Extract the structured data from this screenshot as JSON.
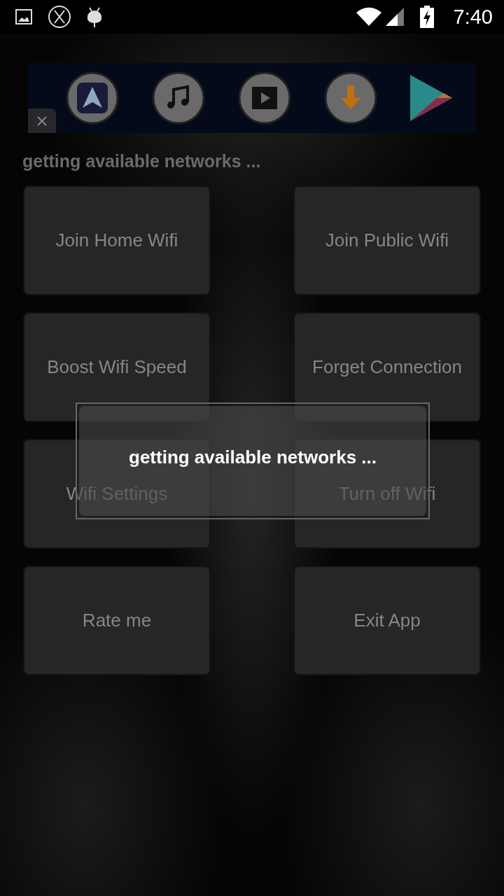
{
  "status_bar": {
    "time": "7:40"
  },
  "status_text": "getting available networks ...",
  "buttons": [
    {
      "label": "Join Home Wifi"
    },
    {
      "label": "Join Public Wifi"
    },
    {
      "label": "Boost Wifi Speed"
    },
    {
      "label": "Forget Connection"
    },
    {
      "label": "Wifi Settings"
    },
    {
      "label": "Turn off Wifi"
    },
    {
      "label": "Rate me"
    },
    {
      "label": "Exit App"
    }
  ],
  "dialog": {
    "message": "getting available networks ..."
  }
}
